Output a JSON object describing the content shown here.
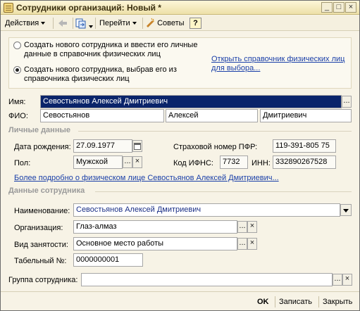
{
  "window": {
    "title": "Сотрудники организаций: Новый *",
    "minimize_glyph": "_",
    "maximize_glyph": "□",
    "close_glyph": "×"
  },
  "toolbar": {
    "actions_label": "Действия",
    "goto_label": "Перейти",
    "tips_label": "Советы",
    "help_label": "?",
    "icons": [
      "back-arrow-icon",
      "replace-icon",
      "tips-icon",
      "help-icon"
    ]
  },
  "radio_group": {
    "option_new_line1": "Создать нового сотрудника и ввести его личные",
    "option_new_line2": "данные в справочник физических лиц",
    "option_select_line1": "Создать нового сотрудника, выбрав его из",
    "option_select_line2": "справочника физических лиц",
    "selected": "select",
    "open_link_line1": "Открыть справочник физических лиц",
    "open_link_line2": "для выбора..."
  },
  "form": {
    "name_label": "Имя:",
    "name_value": "Севостьянов Алексей Дмитриевич",
    "fio_label": "ФИО:",
    "last_name": "Севостьянов",
    "first_name": "Алексей",
    "middle_name": "Дмитриевич",
    "ellipsis": "...",
    "clear": "×"
  },
  "personal": {
    "section_title": "Личные данные",
    "birth_label": "Дата рождения:",
    "birth_value": "27.09.1977",
    "pfr_label": "Страховой номер ПФР:",
    "pfr_value": "119-391-805 75",
    "sex_label": "Пол:",
    "sex_value": "Мужской",
    "ifns_label": "Код ИФНС:",
    "ifns_value": "7732",
    "inn_label": "ИНН:",
    "inn_value": "332890267528",
    "more_link": "Более подробно о физическом лице Севостьянов Алексей Дмитриевич..."
  },
  "employee": {
    "section_title": "Данные сотрудника",
    "title_label": "Наименование:",
    "title_value": "Севостьянов Алексей Дмитриевич",
    "org_label": "Организация:",
    "org_value": "Глаз-алмаз",
    "employment_label": "Вид занятости:",
    "employment_value": "Основное место работы",
    "tab_label": "Табельный №:",
    "tab_value": "0000000001",
    "group_label": "Группа сотрудника:",
    "group_value": ""
  },
  "footer": {
    "ok_label": "OK",
    "save_label": "Записать",
    "close_label": "Закрыть"
  }
}
